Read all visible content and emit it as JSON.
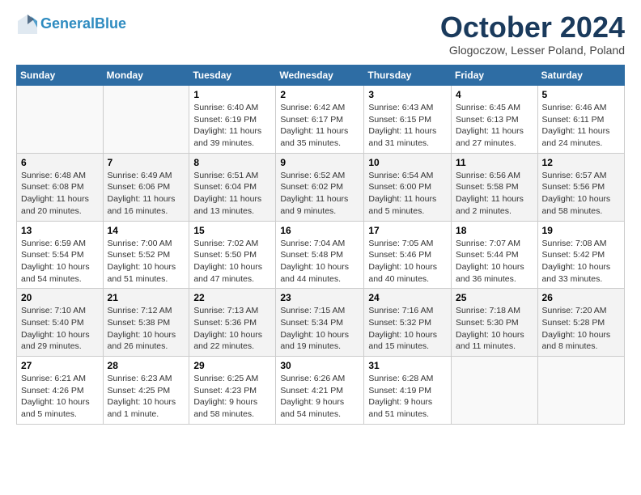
{
  "header": {
    "logo_line1": "General",
    "logo_line2": "Blue",
    "month": "October 2024",
    "location": "Glogoczow, Lesser Poland, Poland"
  },
  "weekdays": [
    "Sunday",
    "Monday",
    "Tuesday",
    "Wednesday",
    "Thursday",
    "Friday",
    "Saturday"
  ],
  "weeks": [
    [
      {
        "day": "",
        "detail": ""
      },
      {
        "day": "",
        "detail": ""
      },
      {
        "day": "1",
        "detail": "Sunrise: 6:40 AM\nSunset: 6:19 PM\nDaylight: 11 hours and 39 minutes."
      },
      {
        "day": "2",
        "detail": "Sunrise: 6:42 AM\nSunset: 6:17 PM\nDaylight: 11 hours and 35 minutes."
      },
      {
        "day": "3",
        "detail": "Sunrise: 6:43 AM\nSunset: 6:15 PM\nDaylight: 11 hours and 31 minutes."
      },
      {
        "day": "4",
        "detail": "Sunrise: 6:45 AM\nSunset: 6:13 PM\nDaylight: 11 hours and 27 minutes."
      },
      {
        "day": "5",
        "detail": "Sunrise: 6:46 AM\nSunset: 6:11 PM\nDaylight: 11 hours and 24 minutes."
      }
    ],
    [
      {
        "day": "6",
        "detail": "Sunrise: 6:48 AM\nSunset: 6:08 PM\nDaylight: 11 hours and 20 minutes."
      },
      {
        "day": "7",
        "detail": "Sunrise: 6:49 AM\nSunset: 6:06 PM\nDaylight: 11 hours and 16 minutes."
      },
      {
        "day": "8",
        "detail": "Sunrise: 6:51 AM\nSunset: 6:04 PM\nDaylight: 11 hours and 13 minutes."
      },
      {
        "day": "9",
        "detail": "Sunrise: 6:52 AM\nSunset: 6:02 PM\nDaylight: 11 hours and 9 minutes."
      },
      {
        "day": "10",
        "detail": "Sunrise: 6:54 AM\nSunset: 6:00 PM\nDaylight: 11 hours and 5 minutes."
      },
      {
        "day": "11",
        "detail": "Sunrise: 6:56 AM\nSunset: 5:58 PM\nDaylight: 11 hours and 2 minutes."
      },
      {
        "day": "12",
        "detail": "Sunrise: 6:57 AM\nSunset: 5:56 PM\nDaylight: 10 hours and 58 minutes."
      }
    ],
    [
      {
        "day": "13",
        "detail": "Sunrise: 6:59 AM\nSunset: 5:54 PM\nDaylight: 10 hours and 54 minutes."
      },
      {
        "day": "14",
        "detail": "Sunrise: 7:00 AM\nSunset: 5:52 PM\nDaylight: 10 hours and 51 minutes."
      },
      {
        "day": "15",
        "detail": "Sunrise: 7:02 AM\nSunset: 5:50 PM\nDaylight: 10 hours and 47 minutes."
      },
      {
        "day": "16",
        "detail": "Sunrise: 7:04 AM\nSunset: 5:48 PM\nDaylight: 10 hours and 44 minutes."
      },
      {
        "day": "17",
        "detail": "Sunrise: 7:05 AM\nSunset: 5:46 PM\nDaylight: 10 hours and 40 minutes."
      },
      {
        "day": "18",
        "detail": "Sunrise: 7:07 AM\nSunset: 5:44 PM\nDaylight: 10 hours and 36 minutes."
      },
      {
        "day": "19",
        "detail": "Sunrise: 7:08 AM\nSunset: 5:42 PM\nDaylight: 10 hours and 33 minutes."
      }
    ],
    [
      {
        "day": "20",
        "detail": "Sunrise: 7:10 AM\nSunset: 5:40 PM\nDaylight: 10 hours and 29 minutes."
      },
      {
        "day": "21",
        "detail": "Sunrise: 7:12 AM\nSunset: 5:38 PM\nDaylight: 10 hours and 26 minutes."
      },
      {
        "day": "22",
        "detail": "Sunrise: 7:13 AM\nSunset: 5:36 PM\nDaylight: 10 hours and 22 minutes."
      },
      {
        "day": "23",
        "detail": "Sunrise: 7:15 AM\nSunset: 5:34 PM\nDaylight: 10 hours and 19 minutes."
      },
      {
        "day": "24",
        "detail": "Sunrise: 7:16 AM\nSunset: 5:32 PM\nDaylight: 10 hours and 15 minutes."
      },
      {
        "day": "25",
        "detail": "Sunrise: 7:18 AM\nSunset: 5:30 PM\nDaylight: 10 hours and 11 minutes."
      },
      {
        "day": "26",
        "detail": "Sunrise: 7:20 AM\nSunset: 5:28 PM\nDaylight: 10 hours and 8 minutes."
      }
    ],
    [
      {
        "day": "27",
        "detail": "Sunrise: 6:21 AM\nSunset: 4:26 PM\nDaylight: 10 hours and 5 minutes."
      },
      {
        "day": "28",
        "detail": "Sunrise: 6:23 AM\nSunset: 4:25 PM\nDaylight: 10 hours and 1 minute."
      },
      {
        "day": "29",
        "detail": "Sunrise: 6:25 AM\nSunset: 4:23 PM\nDaylight: 9 hours and 58 minutes."
      },
      {
        "day": "30",
        "detail": "Sunrise: 6:26 AM\nSunset: 4:21 PM\nDaylight: 9 hours and 54 minutes."
      },
      {
        "day": "31",
        "detail": "Sunrise: 6:28 AM\nSunset: 4:19 PM\nDaylight: 9 hours and 51 minutes."
      },
      {
        "day": "",
        "detail": ""
      },
      {
        "day": "",
        "detail": ""
      }
    ]
  ]
}
